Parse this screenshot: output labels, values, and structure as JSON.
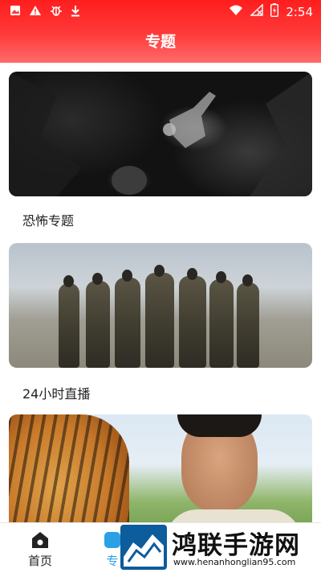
{
  "status_bar": {
    "time": "2:54",
    "left_icons": [
      "image-icon",
      "alert-icon",
      "bug-icon",
      "download-icon"
    ],
    "right_icons": [
      "wifi-icon",
      "no-signal-icon",
      "battery-charging-icon"
    ]
  },
  "header": {
    "title": "专题"
  },
  "topics": [
    {
      "label": "恐怖专题",
      "image": "cave-climbing-image"
    },
    {
      "label": "24小时直播",
      "image": "soldiers-image"
    },
    {
      "label": "",
      "image": "tiger-and-man-image"
    }
  ],
  "bottom_nav": {
    "items": [
      {
        "label": "首页",
        "icon": "home-icon",
        "active": false
      },
      {
        "label": "专",
        "icon": "topic-icon",
        "active": true
      }
    ]
  },
  "watermark": {
    "title": "鸿联手游网",
    "url": "www.henanhonglian95.com"
  },
  "colors": {
    "header_top": "#ff1e1e",
    "header_bottom": "#ff6b6b",
    "active_tab": "#2aa1e6"
  }
}
